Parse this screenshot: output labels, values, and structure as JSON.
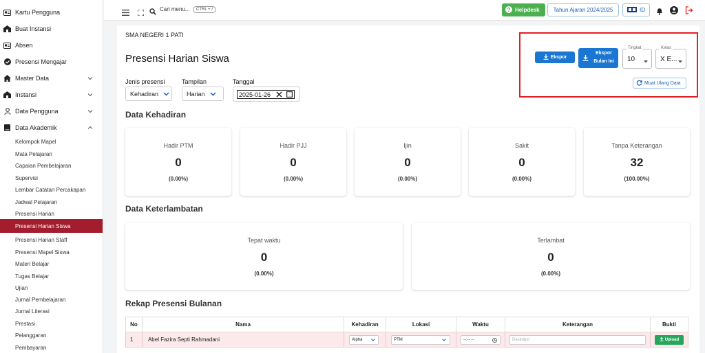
{
  "sidebar": {
    "top_items": [
      {
        "label": "Kartu Pengguna",
        "icon": "id-card-icon"
      },
      {
        "label": "Buat Instansi",
        "icon": "building-icon"
      },
      {
        "label": "Absen",
        "icon": "id-card-icon"
      },
      {
        "label": "Presensi Mengajar",
        "icon": "check-circle-icon"
      },
      {
        "label": "Master Data",
        "icon": "home-icon"
      },
      {
        "label": "Instansi",
        "icon": "building-icon"
      },
      {
        "label": "Data Pengguna",
        "icon": "user-icon"
      },
      {
        "label": "Data Akademik",
        "icon": "book-icon"
      }
    ],
    "sub_items": [
      {
        "label": "Kelompok Mapel"
      },
      {
        "label": "Mata Pelajaran"
      },
      {
        "label": "Capaian Pembelajaran"
      },
      {
        "label": "Supervisi"
      },
      {
        "label": "Lembar Catatan Percakapan"
      },
      {
        "label": "Jadwal Pelajaran"
      },
      {
        "label": "Presensi Harian"
      },
      {
        "label": "Presensi Harian Siswa"
      },
      {
        "label": "Presensi Harian Staff"
      },
      {
        "label": "Presensi Mapel Siswa"
      },
      {
        "label": "Materi Belajar"
      },
      {
        "label": "Tugas Belajar"
      },
      {
        "label": "Ujian"
      },
      {
        "label": "Jurnal Pembelajaran"
      },
      {
        "label": "Jurnal Literasi"
      },
      {
        "label": "Prestasi"
      },
      {
        "label": "Pelanggaran"
      },
      {
        "label": "Pembayaran"
      }
    ],
    "active_sub": "Presensi Harian Siswa"
  },
  "topbar": {
    "search_label": "Cari menu...",
    "search_shortcut": "CTRL + /",
    "helpdesk_label": "Helpdesk",
    "tahun_label": "Tahun Ajaran 2024/2025",
    "lang_label": "ID"
  },
  "main": {
    "school": "SMA NEGERI 1 PATI",
    "title": "Presensi Harian Siswa",
    "filters": {
      "jenis_label": "Jenis presensi",
      "jenis_value": "Kehadiran",
      "tampilan_label": "Tampilan",
      "tampilan_value": "Harian",
      "tanggal_label": "Tanggal",
      "tanggal_value": "2025-01-26"
    },
    "actions": {
      "ekspor_label": "Ekspor",
      "ekspor_bulan_label_1": "Ekspor",
      "ekspor_bulan_label_2": "Bulan Ini",
      "tingkat_label": "Tingkat",
      "tingkat_value": "10",
      "kelas_label": "Kelas",
      "kelas_value": "X E...",
      "muat_label": "Muat Ulang Data"
    },
    "kehadiran_title": "Data Kehadiran",
    "kehadiran_cards": [
      {
        "label": "Hadir PTM",
        "value": "0",
        "pct": "(0.00%)"
      },
      {
        "label": "Hadir PJJ",
        "value": "0",
        "pct": "(0.00%)"
      },
      {
        "label": "Ijin",
        "value": "0",
        "pct": "(0.00%)"
      },
      {
        "label": "Sakit",
        "value": "0",
        "pct": "(0.00%)"
      },
      {
        "label": "Tanpa Keterangan",
        "value": "32",
        "pct": "(100.00%)"
      }
    ],
    "keterlambatan_title": "Data Keterlambatan",
    "keterlambatan_cards": [
      {
        "label": "Tepat waktu",
        "value": "0",
        "pct": "(0.00%)"
      },
      {
        "label": "Terlambat",
        "value": "0",
        "pct": "(0.00%)"
      }
    ],
    "rekap_title": "Rekap Presensi Bulanan",
    "table": {
      "headers": [
        "No",
        "Nama",
        "Kehadiran",
        "Lokasi",
        "Waktu",
        "Keterangan",
        "Bukti"
      ],
      "rows": [
        {
          "no": "1",
          "nama": "Abel Fazira Septi Rahmadani",
          "kehadiran": "Alpha",
          "lokasi": "PTM",
          "waktu": "--:-- --",
          "keterangan_placeholder": "Deskripsi",
          "bukti": "Upload"
        }
      ]
    }
  },
  "colors": {
    "active_sidebar": "#a31d2e",
    "primary_button": "#1976d2",
    "helpdesk": "#4caf50",
    "highlight": "#e51c23",
    "upload": "#26a65b"
  }
}
